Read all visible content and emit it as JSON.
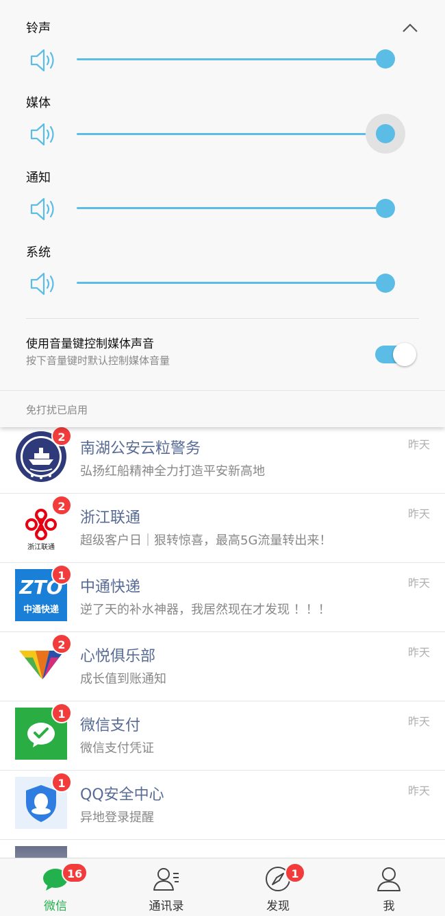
{
  "volume_panel": {
    "streams": [
      {
        "label": "铃声",
        "level": 1.0
      },
      {
        "label": "媒体",
        "level": 1.0
      },
      {
        "label": "通知",
        "level": 1.0
      },
      {
        "label": "系统",
        "level": 1.0
      }
    ],
    "media_key_option": {
      "title": "使用音量键控制媒体声音",
      "subtitle": "按下音量键时默认控制媒体音量",
      "enabled": true
    },
    "dnd_status": "免打扰已启用"
  },
  "chats": [
    {
      "name": "南湖公安云粒警务",
      "message": "弘扬红船精神全力打造平安新高地",
      "time": "昨天",
      "badge": "2",
      "avatar": "police-badge"
    },
    {
      "name": "浙江联通",
      "message": "超级客户日｜狠转惊喜，最高5G流量转出来！",
      "time": "昨天",
      "badge": "2",
      "avatar": "unicom-logo",
      "avatar_text": "浙江联通"
    },
    {
      "name": "中通快递",
      "message": "逆了天的补水神器，我居然现在才发现 ！！！",
      "time": "昨天",
      "badge": "1",
      "avatar": "zto-logo",
      "avatar_text": "ZTO",
      "avatar_subtext": "中通快递"
    },
    {
      "name": "心悦俱乐部",
      "message": "成长值到账通知",
      "time": "昨天",
      "badge": "2",
      "avatar": "xinyue-logo"
    },
    {
      "name": "微信支付",
      "message": "微信支付凭证",
      "time": "昨天",
      "badge": "1",
      "avatar": "wechat-pay-logo"
    },
    {
      "name": "QQ安全中心",
      "message": "异地登录提醒",
      "time": "昨天",
      "badge": "1",
      "avatar": "qq-security-logo"
    }
  ],
  "tabs": [
    {
      "label": "微信",
      "icon": "chat-bubble-icon",
      "badge": "16",
      "active": true
    },
    {
      "label": "通讯录",
      "icon": "contacts-icon",
      "badge": "",
      "active": false
    },
    {
      "label": "发现",
      "icon": "compass-icon",
      "badge": "1",
      "active": false
    },
    {
      "label": "我",
      "icon": "person-icon",
      "badge": "",
      "active": false
    }
  ],
  "colors": {
    "accent": "#5bbde6",
    "badge": "#f23c3c",
    "chat_name": "#576b95",
    "tab_active": "#22b14c"
  }
}
